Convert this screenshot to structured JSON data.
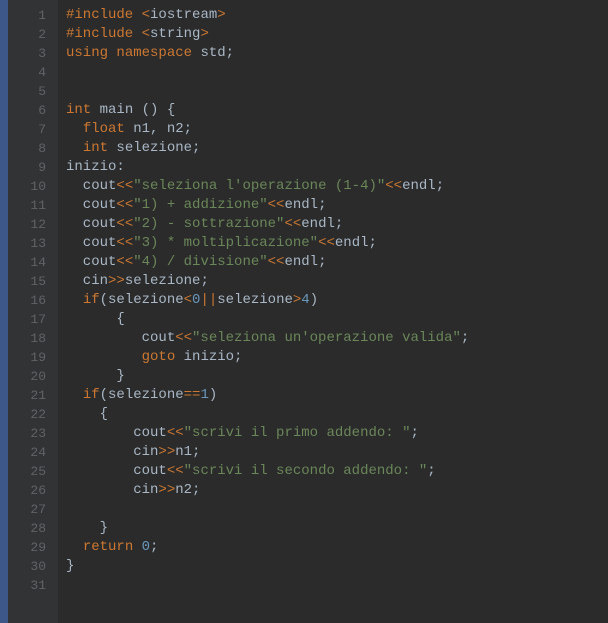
{
  "lines": [
    {
      "num": "1",
      "tokens": [
        [
          "#include ",
          "preproc"
        ],
        [
          "<",
          "op"
        ],
        [
          "iostream",
          "incfile"
        ],
        [
          ">",
          "op"
        ]
      ]
    },
    {
      "num": "2",
      "tokens": [
        [
          "#include ",
          "preproc"
        ],
        [
          "<",
          "op"
        ],
        [
          "string",
          "incfile"
        ],
        [
          ">",
          "op"
        ]
      ]
    },
    {
      "num": "3",
      "tokens": [
        [
          "using ",
          "keyword"
        ],
        [
          "namespace ",
          "keyword"
        ],
        [
          "std;",
          "default"
        ]
      ]
    },
    {
      "num": "4",
      "tokens": []
    },
    {
      "num": "5",
      "tokens": []
    },
    {
      "num": "6",
      "tokens": [
        [
          "int ",
          "type"
        ],
        [
          "main () {",
          "default"
        ]
      ],
      "fold": true
    },
    {
      "num": "7",
      "tokens": [
        [
          "  ",
          "default"
        ],
        [
          "float ",
          "type"
        ],
        [
          "n1, n2;",
          "default"
        ]
      ]
    },
    {
      "num": "8",
      "tokens": [
        [
          "  ",
          "default"
        ],
        [
          "int ",
          "type"
        ],
        [
          "selezione;",
          "default"
        ]
      ]
    },
    {
      "num": "9",
      "tokens": [
        [
          "inizio:",
          "default"
        ]
      ]
    },
    {
      "num": "10",
      "tokens": [
        [
          "  cout",
          "default"
        ],
        [
          "<<",
          "op"
        ],
        [
          "\"seleziona l'operazione (1-4)\"",
          "string"
        ],
        [
          "<<",
          "op"
        ],
        [
          "endl;",
          "default"
        ]
      ]
    },
    {
      "num": "11",
      "tokens": [
        [
          "  cout",
          "default"
        ],
        [
          "<<",
          "op"
        ],
        [
          "\"1) + addizione\"",
          "string"
        ],
        [
          "<<",
          "op"
        ],
        [
          "endl;",
          "default"
        ]
      ]
    },
    {
      "num": "12",
      "tokens": [
        [
          "  cout",
          "default"
        ],
        [
          "<<",
          "op"
        ],
        [
          "\"2) - sottrazione\"",
          "string"
        ],
        [
          "<<",
          "op"
        ],
        [
          "endl;",
          "default"
        ]
      ]
    },
    {
      "num": "13",
      "tokens": [
        [
          "  cout",
          "default"
        ],
        [
          "<<",
          "op"
        ],
        [
          "\"3) * moltiplicazione\"",
          "string"
        ],
        [
          "<<",
          "op"
        ],
        [
          "endl;",
          "default"
        ]
      ]
    },
    {
      "num": "14",
      "tokens": [
        [
          "  cout",
          "default"
        ],
        [
          "<<",
          "op"
        ],
        [
          "\"4) / divisione\"",
          "string"
        ],
        [
          "<<",
          "op"
        ],
        [
          "endl;",
          "default"
        ]
      ]
    },
    {
      "num": "15",
      "tokens": [
        [
          "  cin",
          "default"
        ],
        [
          ">>",
          "op"
        ],
        [
          "selezione;",
          "default"
        ]
      ]
    },
    {
      "num": "16",
      "tokens": [
        [
          "  ",
          "default"
        ],
        [
          "if",
          "keyword"
        ],
        [
          "(selezione",
          "default"
        ],
        [
          "<",
          "op"
        ],
        [
          "0",
          "number"
        ],
        [
          "||",
          "op"
        ],
        [
          "selezione",
          "default"
        ],
        [
          ">",
          "op"
        ],
        [
          "4",
          "number"
        ],
        [
          ")",
          "default"
        ]
      ]
    },
    {
      "num": "17",
      "tokens": [
        [
          "      {",
          "default"
        ]
      ],
      "fold": true
    },
    {
      "num": "18",
      "tokens": [
        [
          "         cout",
          "default"
        ],
        [
          "<<",
          "op"
        ],
        [
          "\"seleziona un'operazione valida\"",
          "string"
        ],
        [
          ";",
          "default"
        ]
      ]
    },
    {
      "num": "19",
      "tokens": [
        [
          "         ",
          "default"
        ],
        [
          "goto ",
          "keyword"
        ],
        [
          "inizio;",
          "default"
        ]
      ]
    },
    {
      "num": "20",
      "tokens": [
        [
          "      }",
          "default"
        ]
      ]
    },
    {
      "num": "21",
      "tokens": [
        [
          "  ",
          "default"
        ],
        [
          "if",
          "keyword"
        ],
        [
          "(selezione",
          "default"
        ],
        [
          "==",
          "op"
        ],
        [
          "1",
          "number"
        ],
        [
          ")",
          "default"
        ]
      ]
    },
    {
      "num": "22",
      "tokens": [
        [
          "    {",
          "default"
        ]
      ],
      "fold": true
    },
    {
      "num": "23",
      "tokens": [
        [
          "        cout",
          "default"
        ],
        [
          "<<",
          "op"
        ],
        [
          "\"scrivi il primo addendo: \"",
          "string"
        ],
        [
          ";",
          "default"
        ]
      ]
    },
    {
      "num": "24",
      "tokens": [
        [
          "        cin",
          "default"
        ],
        [
          ">>",
          "op"
        ],
        [
          "n1;",
          "default"
        ]
      ]
    },
    {
      "num": "25",
      "tokens": [
        [
          "        cout",
          "default"
        ],
        [
          "<<",
          "op"
        ],
        [
          "\"scrivi il secondo addendo: \"",
          "string"
        ],
        [
          ";",
          "default"
        ]
      ]
    },
    {
      "num": "26",
      "tokens": [
        [
          "        cin",
          "default"
        ],
        [
          ">>",
          "op"
        ],
        [
          "n2;",
          "default"
        ]
      ]
    },
    {
      "num": "27",
      "tokens": []
    },
    {
      "num": "28",
      "tokens": [
        [
          "    }",
          "default"
        ]
      ]
    },
    {
      "num": "29",
      "tokens": [
        [
          "  ",
          "default"
        ],
        [
          "return ",
          "keyword"
        ],
        [
          "0",
          "number"
        ],
        [
          ";",
          "default"
        ]
      ]
    },
    {
      "num": "30",
      "tokens": [
        [
          "}",
          "default"
        ]
      ]
    },
    {
      "num": "31",
      "tokens": []
    }
  ]
}
